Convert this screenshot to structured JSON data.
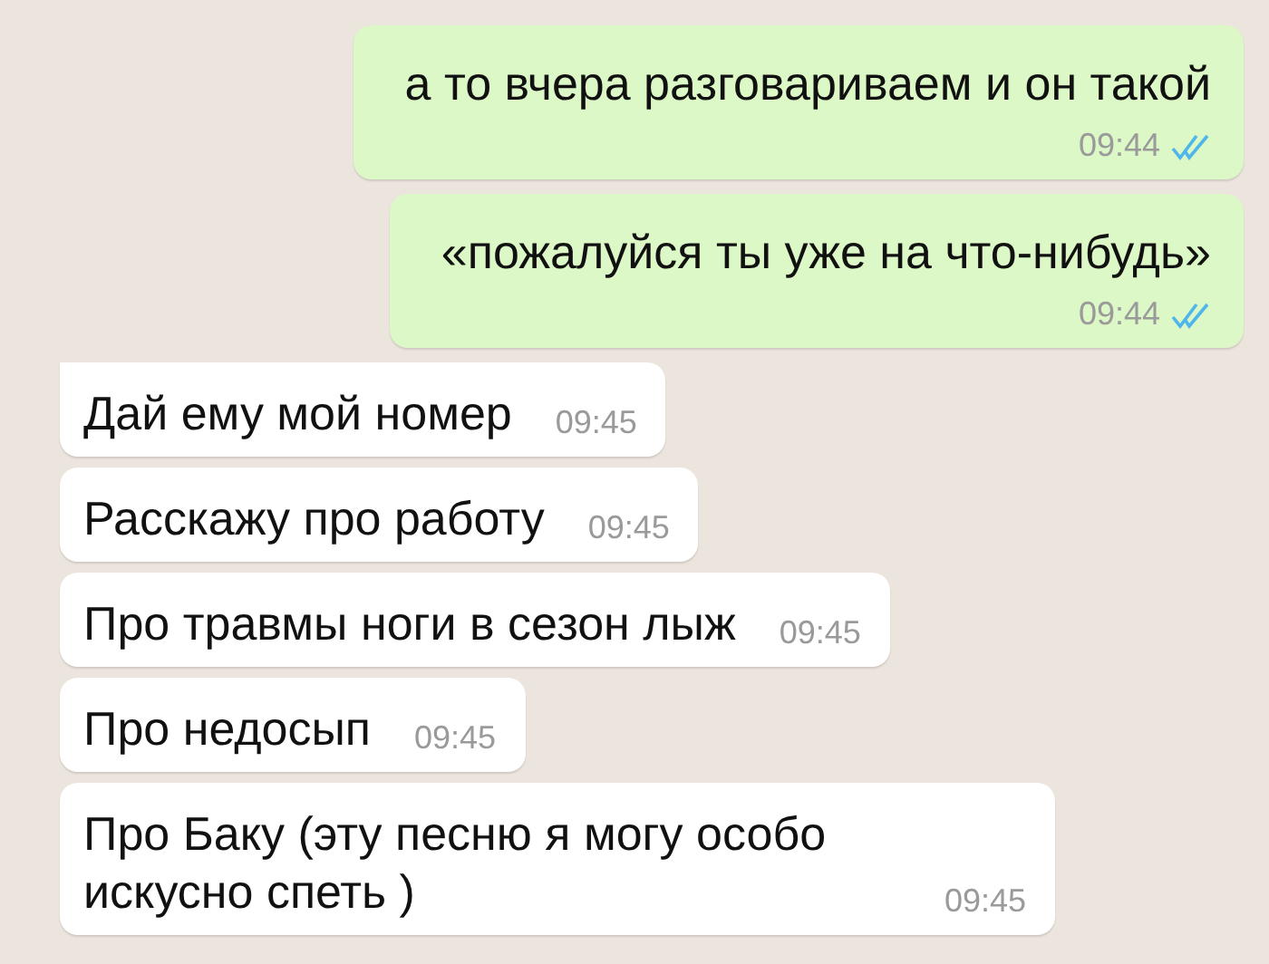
{
  "messages": [
    {
      "kind": "outgoing",
      "text": "а то вчера разговариваем и он такой",
      "time": "09:44",
      "read": true
    },
    {
      "kind": "outgoing",
      "text": "«пожалуйся ты уже на что-нибудь»",
      "time": "09:44",
      "read": true
    },
    {
      "kind": "incoming",
      "text": "Дай ему мой номер",
      "time": "09:45"
    },
    {
      "kind": "incoming",
      "text": "Расскажу про работу",
      "time": "09:45"
    },
    {
      "kind": "incoming",
      "text": "Про травмы ноги в сезон лыж",
      "time": "09:45"
    },
    {
      "kind": "incoming",
      "text": "Про недосып",
      "time": "09:45"
    },
    {
      "kind": "incoming",
      "text": "Про Баку (эту песню я могу особо искусно спеть )",
      "time": "09:45"
    }
  ]
}
